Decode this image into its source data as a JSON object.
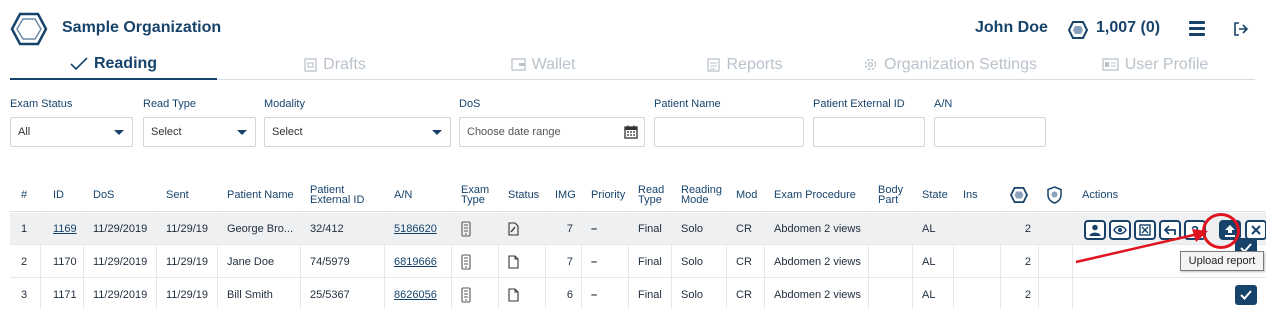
{
  "header": {
    "org_name": "Sample Organization",
    "user_name": "John Doe",
    "credits": "1,007 (0)",
    "brand_color": "#17436b"
  },
  "tabs": [
    {
      "label": "Reading",
      "icon": "check-icon",
      "active": true
    },
    {
      "label": "Drafts",
      "icon": "draft-icon",
      "active": false
    },
    {
      "label": "Wallet",
      "icon": "wallet-icon",
      "active": false
    },
    {
      "label": "Reports",
      "icon": "reports-icon",
      "active": false
    },
    {
      "label": "Organization Settings",
      "icon": "gear-icon",
      "active": false
    },
    {
      "label": "User Profile",
      "icon": "id-card-icon",
      "active": false
    }
  ],
  "filters": {
    "exam_status": {
      "label": "Exam Status",
      "value": "All"
    },
    "read_type": {
      "label": "Read Type",
      "value": "Select"
    },
    "modality": {
      "label": "Modality",
      "value": "Select"
    },
    "dos": {
      "label": "DoS",
      "placeholder": "Choose date range"
    },
    "patient_name": {
      "label": "Patient Name",
      "value": ""
    },
    "patient_external_id": {
      "label": "Patient External ID",
      "value": ""
    },
    "an": {
      "label": "A/N",
      "value": ""
    }
  },
  "table": {
    "headers": {
      "num": "#",
      "id": "ID",
      "dos": "DoS",
      "sent": "Sent",
      "patient_name": "Patient Name",
      "patient_ext_1": "Patient",
      "patient_ext_2": "External ID",
      "an": "A/N",
      "exam_type_1": "Exam",
      "exam_type_2": "Type",
      "status": "Status",
      "img": "IMG",
      "priority": "Priority",
      "read_type_1": "Read",
      "read_type_2": "Type",
      "reading_mode_1": "Reading",
      "reading_mode_2": "Mode",
      "mod": "Mod",
      "exam_procedure": "Exam Procedure",
      "body_part_1": "Body",
      "body_part_2": "Part",
      "state": "State",
      "ins": "Ins",
      "actions": "Actions"
    },
    "rows": [
      {
        "num": "1",
        "id": "1169",
        "dos": "11/29/2019",
        "sent": "11/29/19",
        "patient_name": "George Bro...",
        "patient_ext_id": "32/412",
        "an": "5186620",
        "img": "7",
        "priority": "–",
        "read_type": "Final",
        "reading_mode": "Solo",
        "mod": "CR",
        "exam_procedure": "Abdomen 2 views",
        "state": "AL",
        "count": "2"
      },
      {
        "num": "2",
        "id": "1170",
        "dos": "11/29/2019",
        "sent": "11/29/19",
        "patient_name": "Jane Doe",
        "patient_ext_id": "74/5979",
        "an": "6819666",
        "img": "7",
        "priority": "–",
        "read_type": "Final",
        "reading_mode": "Solo",
        "mod": "CR",
        "exam_procedure": "Abdomen 2 views",
        "state": "AL",
        "count": "2"
      },
      {
        "num": "3",
        "id": "1171",
        "dos": "11/29/2019",
        "sent": "11/29/19",
        "patient_name": "Bill Smith",
        "patient_ext_id": "25/5367",
        "an": "8626056",
        "img": "6",
        "priority": "–",
        "read_type": "Final",
        "reading_mode": "Solo",
        "mod": "CR",
        "exam_procedure": "Abdomen 2 views",
        "state": "AL",
        "count": "2"
      }
    ],
    "row_actions": [
      "user-icon",
      "eye-icon",
      "cancel-icon",
      "reply-icon",
      "help-icon",
      "upload-report-icon",
      "close-icon"
    ]
  },
  "tooltip": {
    "text": "Upload report"
  },
  "annotation_color": "#e0141e"
}
